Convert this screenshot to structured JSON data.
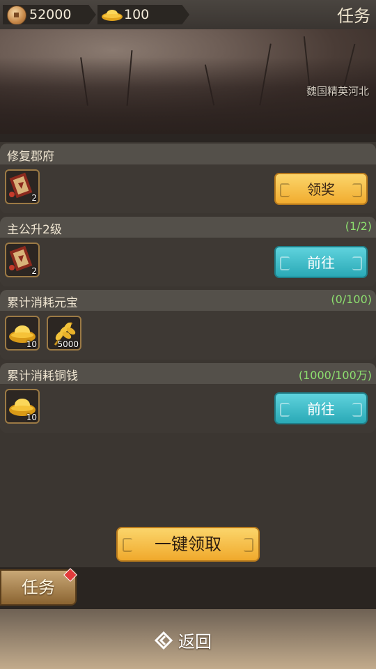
{
  "header": {
    "copper_value": "52000",
    "ingot_value": "100",
    "title": "任务"
  },
  "banner": {
    "caption": "魏国精英河北"
  },
  "tasks": [
    {
      "name": "修复郡府",
      "progress": "",
      "rewards": [
        {
          "icon": "scroll-icon",
          "count": "2"
        }
      ],
      "button": {
        "label": "领奖",
        "style": "gold"
      }
    },
    {
      "name": "主公升2级",
      "progress": "(1/2)",
      "rewards": [
        {
          "icon": "scroll-icon",
          "count": "2"
        }
      ],
      "button": {
        "label": "前往",
        "style": "teal"
      }
    },
    {
      "name": "累计消耗元宝",
      "progress": "(0/100)",
      "rewards": [
        {
          "icon": "gold-ingot-icon",
          "count": "10"
        },
        {
          "icon": "wheat-icon",
          "count": "5000"
        }
      ],
      "button": null
    },
    {
      "name": "累计消耗铜钱",
      "progress": "(1000/100万)",
      "rewards": [
        {
          "icon": "gold-ingot-icon",
          "count": "10"
        }
      ],
      "button": {
        "label": "前往",
        "style": "teal"
      }
    }
  ],
  "claim_all_label": "一键领取",
  "tab": {
    "label": "任务"
  },
  "footer": {
    "back_label": "返回"
  },
  "colors": {
    "progress": "#8de06f",
    "gold_button": "#f1ac2f",
    "teal_button": "#2aa9b6"
  }
}
